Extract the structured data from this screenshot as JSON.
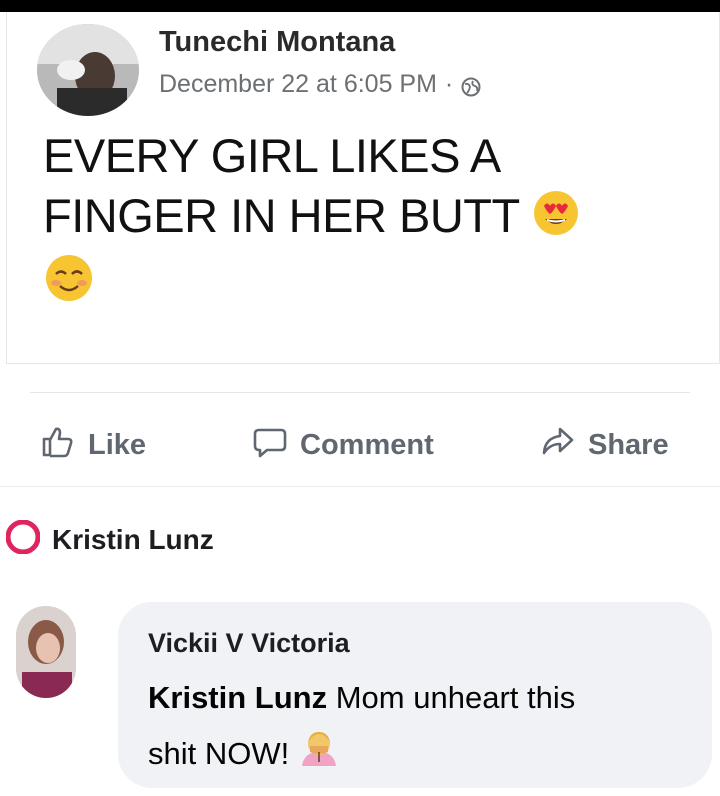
{
  "post": {
    "author": "Tunechi Montana",
    "timestamp": "December 22 at 6:05 PM",
    "separator": "·",
    "privacy_icon": "globe-icon",
    "text_line1": "EVERY GIRL LIKES A",
    "text_line2": "FINGER IN HER BUTT",
    "emoji1": "heart-eyes-emoji",
    "emoji2": "blushing-smile-emoji"
  },
  "actions": {
    "like": "Like",
    "comment": "Comment",
    "share": "Share"
  },
  "reaction": {
    "name": "Kristin Lunz",
    "icon": "heart-reaction-icon"
  },
  "comment": {
    "author": "Vickii V Victoria",
    "mention": "Kristin Lunz",
    "text_part1": "Mom unheart this",
    "text_part2": "shit NOW!",
    "emoji": "facepalm-emoji"
  },
  "colors": {
    "action_gray": "#606770",
    "bubble_bg": "#f0f2f5",
    "heart_red": "#e0245e"
  }
}
